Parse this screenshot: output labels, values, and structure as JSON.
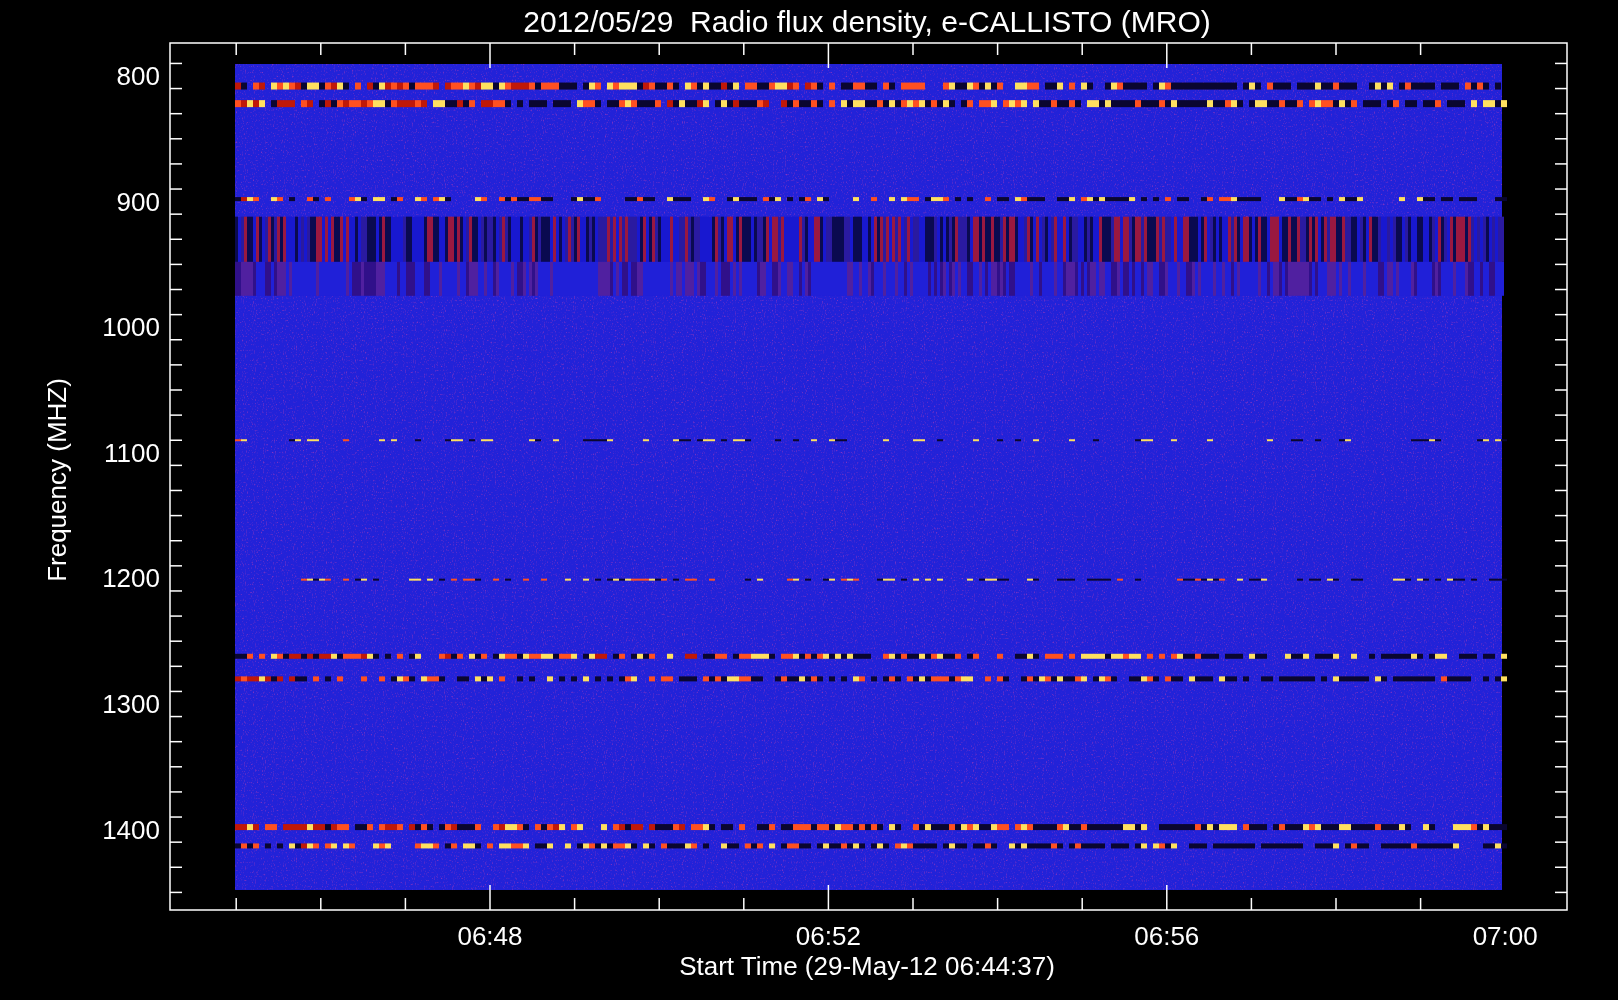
{
  "title": "2012/05/29  Radio flux density, e-CALLISTO (MRO)",
  "y_axis": {
    "label": "Frequency (MHZ)",
    "ticks": [
      "800",
      "900",
      "1000",
      "1100",
      "1200",
      "1300",
      "1400"
    ]
  },
  "x_axis": {
    "label": "Start Time (29-May-12 06:44:37)",
    "ticks": [
      "06:48",
      "06:52",
      "06:56",
      "07:00"
    ]
  }
}
